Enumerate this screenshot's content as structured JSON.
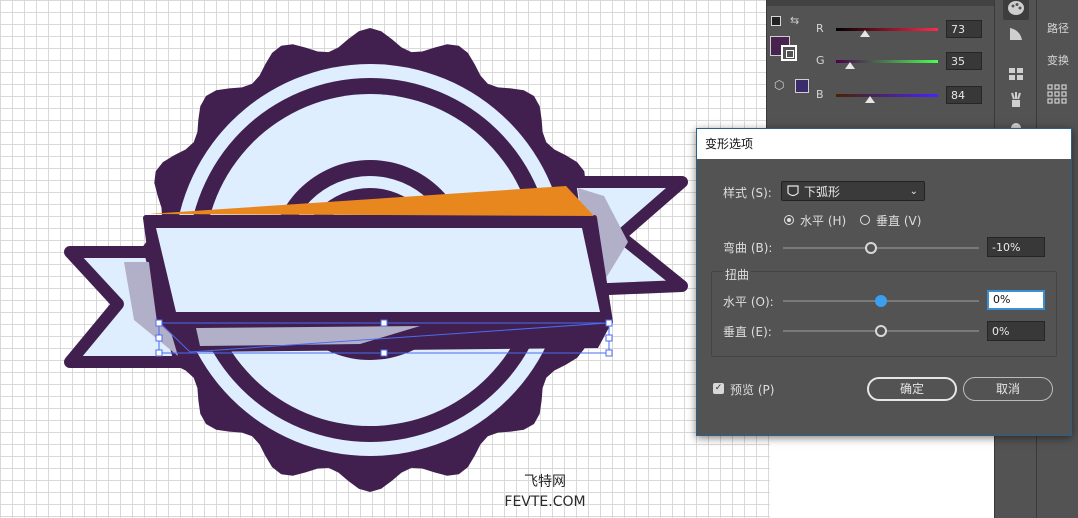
{
  "watermark": {
    "line1": "飞特网",
    "line2": "FEVTE.COM"
  },
  "color_panel": {
    "rows": [
      {
        "label": "R",
        "value": "73",
        "level": 0.286,
        "gradient": [
          "#000000",
          "#ff2a4f"
        ]
      },
      {
        "label": "G",
        "value": "35",
        "level": 0.137,
        "gradient": [
          "#4a004f",
          "#4cff4f"
        ]
      },
      {
        "label": "B",
        "value": "84",
        "level": 0.329,
        "gradient": [
          "#492300",
          "#4923ff"
        ]
      }
    ],
    "fill_color": "#49234f"
  },
  "right_strip": {
    "labels": [
      "路径",
      "变换"
    ]
  },
  "dialog": {
    "title": "变形选项",
    "style_label": "样式 (S):",
    "style_value": "下弧形",
    "orientation": {
      "horizontal_label": "水平 (H)",
      "vertical_label": "垂直 (V)",
      "selected": "horizontal"
    },
    "bend": {
      "label": "弯曲 (B):",
      "value": "-10%",
      "level": -0.1
    },
    "distortion": {
      "group_label": "扭曲",
      "horizontal": {
        "label": "水平 (O):",
        "value": "0%",
        "level": 0
      },
      "vertical": {
        "label": "垂直 (E):",
        "value": "0%",
        "level": 0
      }
    },
    "preview": {
      "label": "预览 (P)",
      "checked": true
    },
    "ok_label": "确定",
    "cancel_label": "取消"
  },
  "colors": {
    "badge_dark": "#41204f",
    "badge_light": "#deeefe",
    "ribbon_shadow": "#b2b0c8",
    "accent_orange": "#e8871e",
    "annotation_arrow": "#e5392b",
    "selection": "#4a6cf0"
  }
}
